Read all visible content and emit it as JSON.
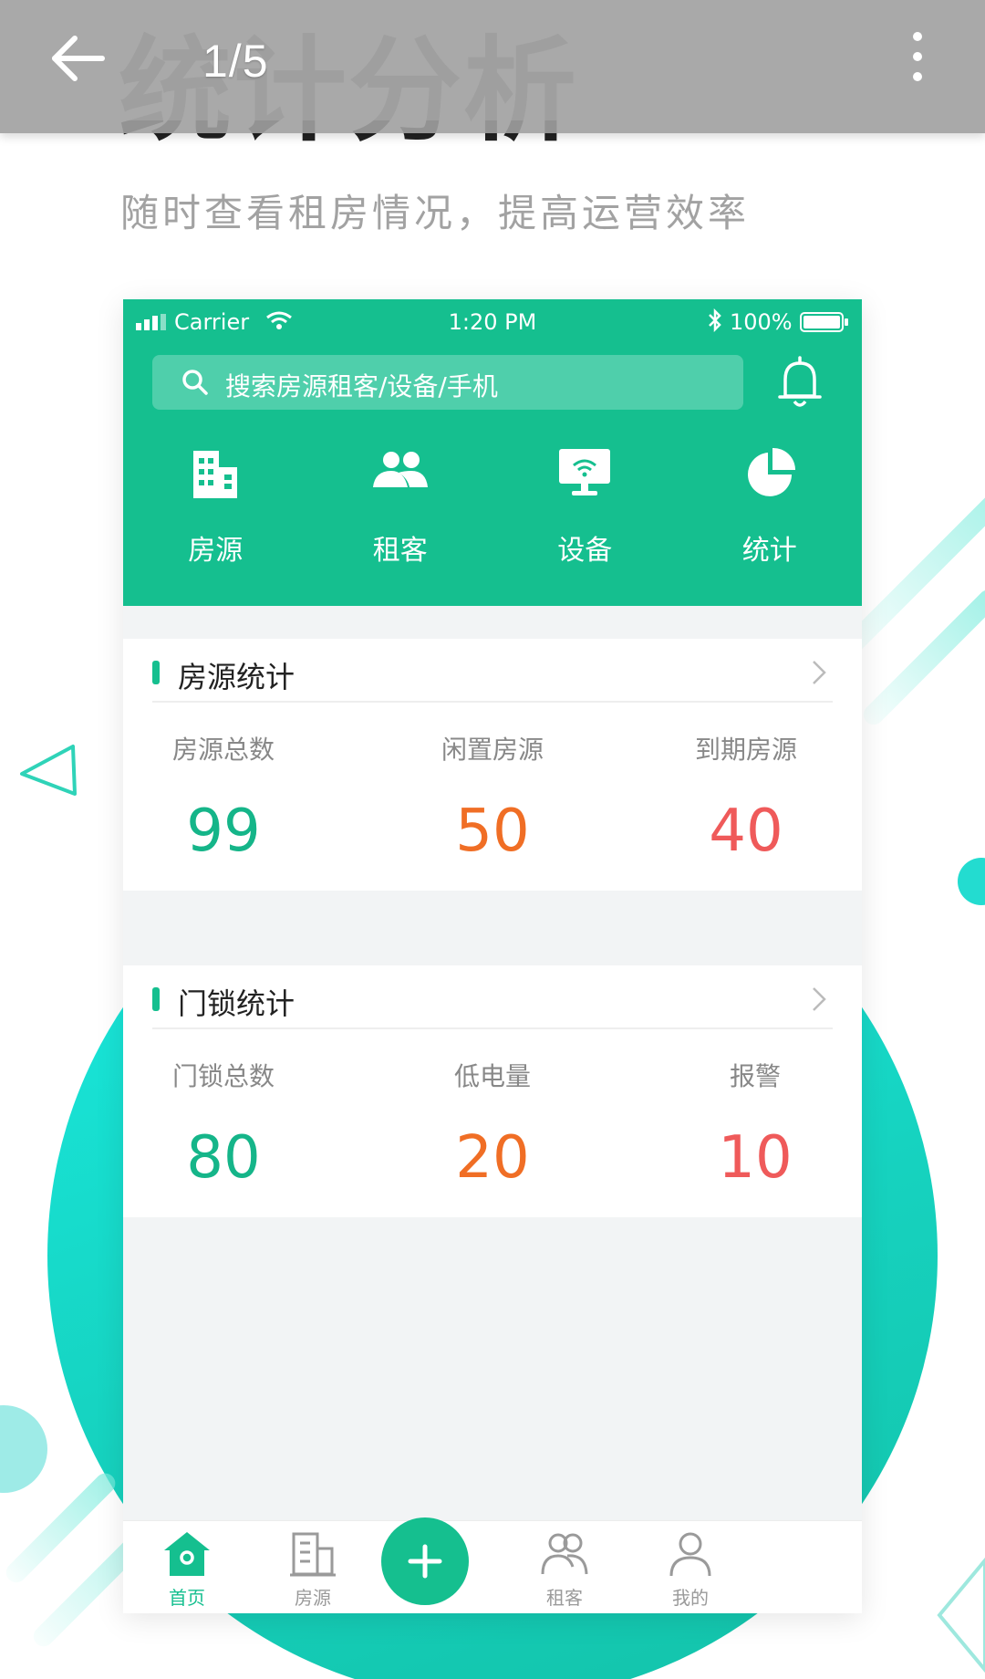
{
  "viewer": {
    "page_counter": "1/5"
  },
  "headline": {
    "title": "统计分析",
    "subtitle": "随时查看租房情况，提高运营效率"
  },
  "phone": {
    "status_bar": {
      "carrier": "Carrier",
      "time": "1:20 PM",
      "battery": "100%"
    },
    "search": {
      "placeholder": "搜索房源租客/设备/手机"
    },
    "quick_nav": [
      {
        "label": "房源",
        "icon": "building-icon"
      },
      {
        "label": "租客",
        "icon": "people-icon"
      },
      {
        "label": "设备",
        "icon": "monitor-wifi-icon"
      },
      {
        "label": "统计",
        "icon": "pie-chart-icon"
      }
    ],
    "housing_stats": {
      "title": "房源统计",
      "items": [
        {
          "label": "房源总数",
          "value": "99"
        },
        {
          "label": "闲置房源",
          "value": "50"
        },
        {
          "label": "到期房源",
          "value": "40"
        }
      ]
    },
    "lock_stats": {
      "title": "门锁统计",
      "items": [
        {
          "label": "门锁总数",
          "value": "80"
        },
        {
          "label": "低电量",
          "value": "20"
        },
        {
          "label": "报警",
          "value": "10"
        }
      ]
    },
    "tabbar": {
      "items": [
        {
          "label": "首页",
          "icon": "home-icon",
          "active": true
        },
        {
          "label": "房源",
          "icon": "building-outline-icon",
          "active": false
        },
        {
          "label": "",
          "icon": "plus-icon",
          "active": false
        },
        {
          "label": "租客",
          "icon": "people-outline-icon",
          "active": false
        },
        {
          "label": "我的",
          "icon": "user-outline-icon",
          "active": false
        }
      ]
    },
    "colors": {
      "brand_green": "#15bf8f",
      "value_green": "#15b589",
      "value_orange": "#f06e25",
      "value_red": "#ef5a5a"
    }
  }
}
